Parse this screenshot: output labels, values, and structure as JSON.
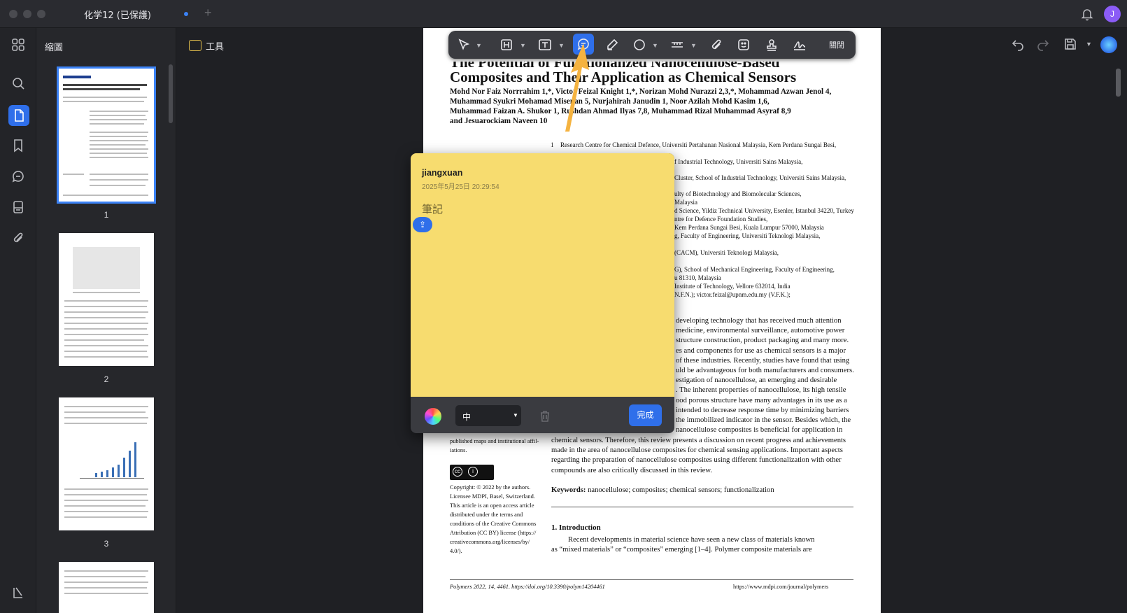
{
  "window": {
    "tab_title": "化学12 (已保護)",
    "avatar_initial": "J"
  },
  "sidebar": {
    "title": "縮圖",
    "pages": [
      "1",
      "2",
      "3"
    ]
  },
  "toolbar": {
    "tools_label": "工具",
    "close_label": "關閉"
  },
  "document": {
    "title_line1": "The Potential of Functionalized Nanocellulose-Based",
    "title_line2": "Composites and Their Application as Chemical Sensors",
    "authors": [
      "Mohd Nor Faiz Norrrahim 1,*, Victor Feizal Knight 1,*, Norizan Mohd Nurazzi 2,3,*, Mohammad Azwan Jenol 4,",
      "Muhammad Syukri Mohamad Misenan 5, Nurjahirah Janudin 1, Noor Azilah Mohd Kasim 1,6,",
      "Muhammad Faizan A. Shukor 1, Rushdan Ahmad Ilyas 7,8, Muhammad Rizal Muhammad Asyraf 8,9",
      "and Jesuarockiam Naveen 10"
    ],
    "affiliations": [
      "Research Centre for Chemical Defence, Universiti Pertahanan Nasional Malaysia, Kem Perdana Sungai Besi,",
      "f Industrial Technology, Universiti Sains Malaysia,",
      "Cluster, School of Industrial Technology, Universiti Sains Malaysia,",
      "ulty of Biotechnology and Biomolecular Sciences,",
      "Malaysia",
      "d Science, Yildiz Technical University, Esenler, Istanbul 34220, Turkey",
      "ntre for Defence Foundation Studies,",
      "Kem Perdana Sungai Besi, Kuala Lumpur 57000, Malaysia",
      "g, Faculty of Engineering, Universiti Teknologi Malaysia,",
      "(CACM), Universiti Teknologi Malaysia,",
      "G), School of Mechanical Engineering, Faculty of Engineering,",
      "u 81310, Malaysia",
      "Institute of Technology, Vellore 632014, India",
      "N.F.N.); victor.feizal@upnm.edu.my (V.F.K.);"
    ],
    "abstract": [
      "developing technology that has received much attention",
      "medicine, environmental surveillance, automotive power",
      "structure construction, product packaging and many more.",
      "es and components for use as chemical sensors is a major",
      "of these industries. Recently, studies have found that using",
      "uld be advantageous for both manufacturers and consumers.",
      "estigation of nanocellulose, an emerging and desirable",
      ". The inherent properties of nanocellulose, its high tensile",
      "ood porous structure have many advantages in its use as a",
      "intended to decrease response time by minimizing barriers",
      "the immobilized indicator in the sensor. Besides which, the",
      "nanocellulose composites is beneficial for application in",
      "chemical sensors. Therefore, this review presents a discussion on recent progress and achievements",
      "made in the area of nanocellulose composites for chemical sensing applications. Important aspects",
      "regarding the preparation of nanocellulose composites using different functionalization with other",
      "compounds are also critically discussed in this review."
    ],
    "keywords_label": "Keywords:",
    "keywords": "nanocellulose; composites; chemical sensors; functionalization",
    "side_note": [
      "published maps and institutional affil-",
      "iations."
    ],
    "copyright": [
      "Copyright: © 2022 by the authors.",
      "Licensee MDPI, Basel, Switzerland.",
      "This article is an open access article",
      "distributed under the terms and",
      "conditions of the Creative Commons",
      "Attribution (CC BY) license (https://",
      "creativecommons.org/licenses/by/",
      "4.0/)."
    ],
    "section_heading": "1. Introduction",
    "intro": [
      "Recent developments in material science have seen a new class of materials known",
      "as “mixed materials” or “composites” emerging [1–4]. Polymer composite materials are"
    ],
    "footer_left": "Polymers 2022, 14, 4461. https://doi.org/10.3390/polym14204461",
    "footer_right": "https://www.mdpi.com/journal/polymers",
    "affiliation_num": "1"
  },
  "note": {
    "author": "jiangxuan",
    "date": "2025年5月25日 20:29:54",
    "text": "筆記",
    "size_value": "中",
    "done_label": "完成",
    "color": "#f7dc6f"
  },
  "colors": {
    "accent": "#2f6fea",
    "arrow": "#f5b340"
  }
}
